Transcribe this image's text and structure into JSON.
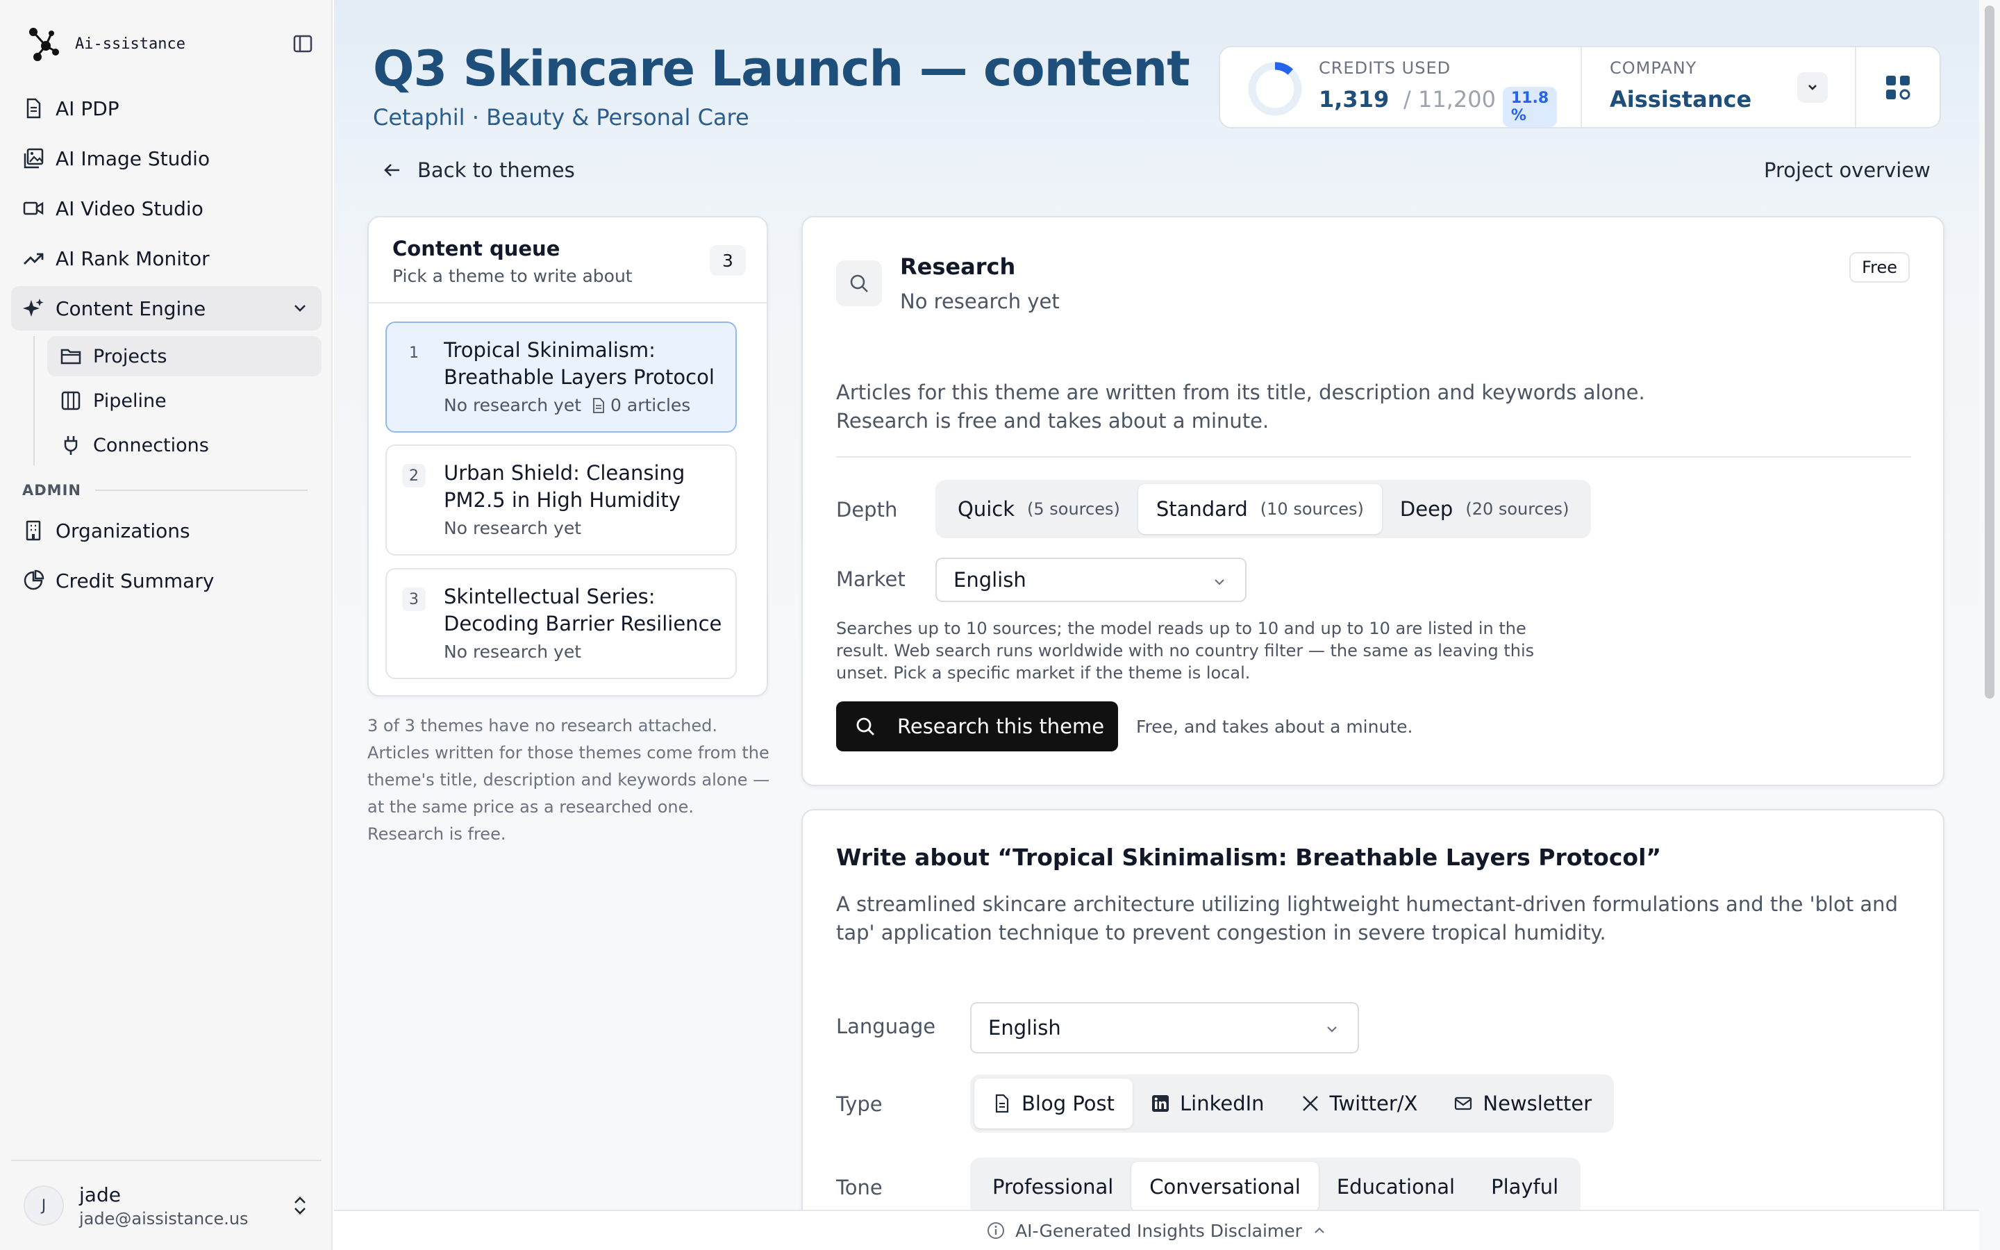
{
  "app": {
    "name": "Ai-ssistance"
  },
  "sidebar": {
    "items": [
      {
        "label": "AI PDP",
        "icon": "document-icon"
      },
      {
        "label": "AI Image Studio",
        "icon": "image-gallery-icon"
      },
      {
        "label": "AI Video Studio",
        "icon": "video-camera-icon"
      },
      {
        "label": "AI Rank Monitor",
        "icon": "trending-up-icon"
      },
      {
        "label": "Content Engine",
        "icon": "sparkles-icon",
        "expanded": true
      }
    ],
    "content_engine_children": [
      {
        "label": "Projects",
        "icon": "folder-icon",
        "selected": true
      },
      {
        "label": "Pipeline",
        "icon": "columns-icon"
      },
      {
        "label": "Connections",
        "icon": "plug-icon"
      }
    ],
    "admin_label": "ADMIN",
    "admin_items": [
      {
        "label": "Organizations",
        "icon": "building-icon"
      },
      {
        "label": "Credit Summary",
        "icon": "pie-chart-icon"
      }
    ],
    "user": {
      "initial": "J",
      "name": "jade",
      "email": "jade@aissistance.us"
    }
  },
  "header": {
    "title": "Q3 Skincare Launch — content",
    "subtitle": "Cetaphil · Beauty & Personal Care",
    "back_label": "Back to themes",
    "overview_label": "Project overview"
  },
  "credits": {
    "label": "CREDITS USED",
    "used": "1,319",
    "total": "/ 11,200",
    "percent_text": "11.8 %",
    "percent_value": 0.118,
    "accent": "#2563eb"
  },
  "company": {
    "label": "COMPANY",
    "name": "Aissistance"
  },
  "queue": {
    "title": "Content queue",
    "subtitle": "Pick a theme to write about",
    "count": "3",
    "themes": [
      {
        "num": "1",
        "title": "Tropical Skinimalism: Breathable Layers Protocol",
        "status": "No research yet",
        "articles": "0 articles",
        "active": true
      },
      {
        "num": "2",
        "title": "Urban Shield: Cleansing PM2.5 in High Humidity",
        "status": "No research yet"
      },
      {
        "num": "3",
        "title": "Skintellectual Series: Decoding Barrier Resilience",
        "status": "No research yet"
      }
    ],
    "note": "3 of 3 themes have no research attached. Articles written for those themes come from the theme's title, description and keywords alone — at the same price as a researched one. Research is free."
  },
  "research": {
    "title": "Research",
    "status": "No research yet",
    "badge": "Free",
    "description": "Articles for this theme are written from its title, description and keywords alone. Research is free and takes about a minute.",
    "depth_label": "Depth",
    "depth_options": [
      {
        "label": "Quick",
        "extra": "(5 sources)"
      },
      {
        "label": "Standard",
        "extra": "(10 sources)",
        "selected": true
      },
      {
        "label": "Deep",
        "extra": "(20 sources)"
      }
    ],
    "market_label": "Market",
    "market_value": "English",
    "help": "Searches up to 10 sources; the model reads up to 10 and up to 10 are listed in the result. Web search runs worldwide with no country filter — the same as leaving this unset. Pick a specific market if the theme is local.",
    "button_label": "Research this theme",
    "button_note": "Free, and takes about a minute."
  },
  "write": {
    "title": "Write about “Tropical Skinimalism: Breathable Layers Protocol”",
    "description": "A streamlined skincare architecture utilizing lightweight humectant-driven formulations and the 'blot and tap' application technique to prevent congestion in severe tropical humidity.",
    "language_label": "Language",
    "language_value": "English",
    "type_label": "Type",
    "types": [
      {
        "label": "Blog Post",
        "icon": "document-icon",
        "selected": true
      },
      {
        "label": "LinkedIn",
        "icon": "linkedin-icon"
      },
      {
        "label": "Twitter/X",
        "icon": "x-logo-icon"
      },
      {
        "label": "Newsletter",
        "icon": "mail-icon"
      }
    ],
    "tone_label": "Tone",
    "tones": [
      {
        "label": "Professional"
      },
      {
        "label": "Conversational",
        "selected": true
      },
      {
        "label": "Educational"
      },
      {
        "label": "Playful"
      }
    ]
  },
  "disclaimer": {
    "label": "AI-Generated Insights Disclaimer"
  }
}
